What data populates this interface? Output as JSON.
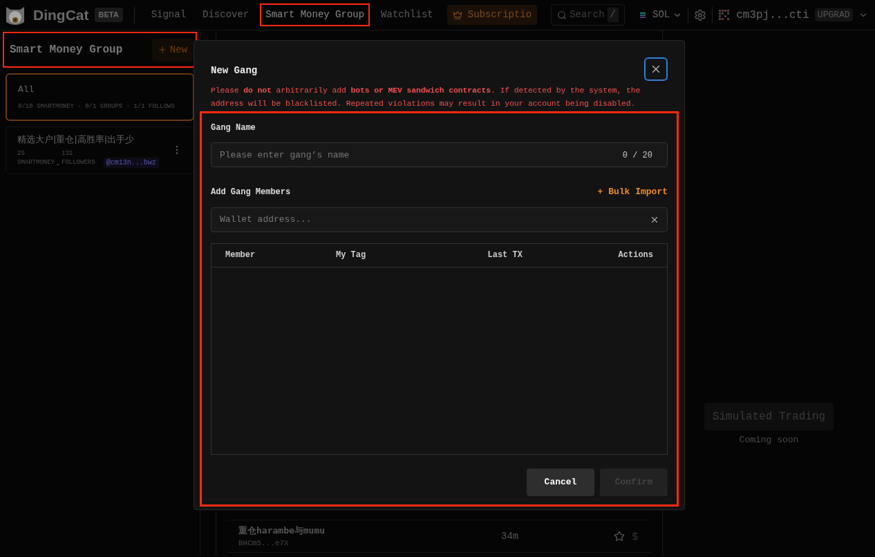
{
  "header": {
    "logo": "DingCat",
    "badge": "BETA",
    "nav": [
      {
        "label": "Signal",
        "selected": false
      },
      {
        "label": "Discover",
        "selected": false
      },
      {
        "label": "Smart Money Group",
        "selected": true
      },
      {
        "label": "Watchlist",
        "selected": false
      }
    ],
    "subscription": "Subscriptio",
    "search": {
      "placeholder": "Search",
      "shortcut": "/"
    },
    "chain": "SOL",
    "account": "cm3pj...cti",
    "upgrade": "UPGRAD"
  },
  "sidebar": {
    "title": "Smart Money Group",
    "new_button": "New",
    "groups": [
      {
        "kind": "summary",
        "name": "All",
        "selected": true,
        "stats": "0/10 SMARTMONEY · 0/1 GROUPS · 1/1 FOLLOWS"
      },
      {
        "kind": "group",
        "name": "精选大户|重仓|高胜率|出手少",
        "selected": false,
        "smartmoney_count": "25",
        "smartmoney_label": "SMARTMONEY",
        "followers_count": "131",
        "followers_label": "FOLLOWERS",
        "creator": "@cm13n...bwz"
      }
    ]
  },
  "list": {
    "rows": [
      {
        "name": "重仓harambe与mumu",
        "address": "BHCm5...e7X",
        "age": "34m"
      }
    ]
  },
  "right_panel": {
    "title": "Simulated Trading",
    "subtitle": "Coming soon"
  },
  "modal": {
    "title": "New Gang",
    "warning": "Please **do not** arbitrarily add **bots or MEV sandwich contracts**. If detected by the system, the address will be blacklisted. Repeated violations may result in your account being disabled.",
    "name_label": "Gang Name",
    "name_placeholder": "Please enter gang’s name",
    "name_counter": "0 / 20",
    "members_label": "Add Gang Members",
    "bulk_import": "+ Bulk Import",
    "wallet_placeholder": "Wallet address...",
    "columns": [
      "Member",
      "My Tag",
      "Last TX",
      "Actions"
    ],
    "cancel": "Cancel",
    "confirm": {
      "label": "Confirm",
      "disabled": true
    }
  }
}
